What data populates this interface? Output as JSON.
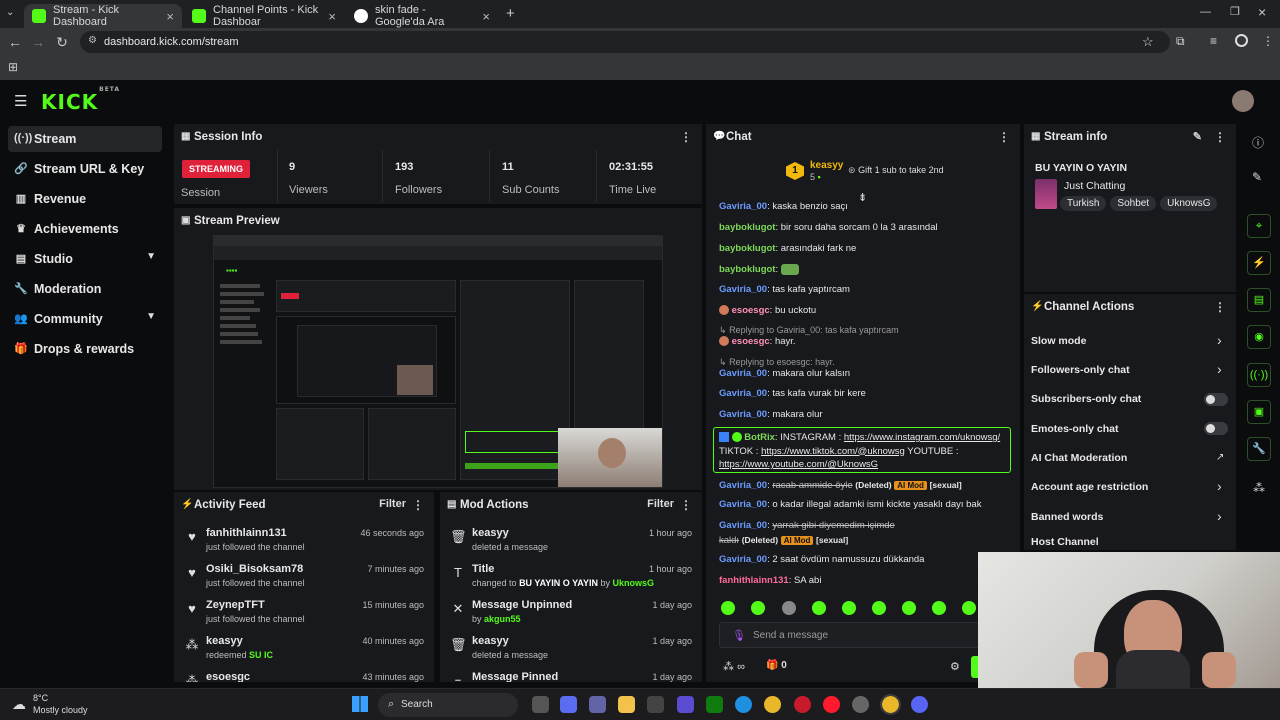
{
  "browser": {
    "tabs": [
      {
        "label": "Stream - Kick Dashboard",
        "active": true
      },
      {
        "label": "Channel Points - Kick Dashboar",
        "active": false
      },
      {
        "label": "skin fade - Google'da Ara",
        "active": false
      }
    ],
    "url": "dashboard.kick.com/stream"
  },
  "brand": {
    "logo": "KICK",
    "beta": "BETA",
    "accent": "#53fc18"
  },
  "sidebar": {
    "items": [
      {
        "label": "Stream",
        "icon": "signal-icon",
        "active": true
      },
      {
        "label": "Stream URL & Key",
        "icon": "link-icon"
      },
      {
        "label": "Revenue",
        "icon": "bank-icon"
      },
      {
        "label": "Achievements",
        "icon": "trophy-icon"
      },
      {
        "label": "Studio",
        "icon": "layers-icon",
        "expandable": true
      },
      {
        "label": "Moderation",
        "icon": "wrench-icon"
      },
      {
        "label": "Community",
        "icon": "people-icon",
        "expandable": true
      },
      {
        "label": "Drops & rewards",
        "icon": "gift-icon"
      }
    ]
  },
  "session": {
    "title": "Session Info",
    "status": "STREAMING",
    "status_label": "Session",
    "stats": [
      {
        "value": "9",
        "label": "Viewers"
      },
      {
        "value": "193",
        "label": "Followers"
      },
      {
        "value": "11",
        "label": "Sub Counts"
      },
      {
        "value": "02:31:55",
        "label": "Time Live"
      }
    ]
  },
  "preview": {
    "title": "Stream Preview"
  },
  "activity": {
    "title": "Activity Feed",
    "filter": "Filter",
    "rows": [
      {
        "name": "fanhithlainn131",
        "sub": "just followed the channel",
        "when": "46 seconds ago",
        "icon": "heart-icon"
      },
      {
        "name": "Osiki_Bisoksam78",
        "sub": "just followed the channel",
        "when": "7 minutes ago",
        "icon": "heart-icon"
      },
      {
        "name": "ZeynepTFT",
        "sub": "just followed the channel",
        "when": "15 minutes ago",
        "icon": "heart-icon"
      },
      {
        "name": "keasyy",
        "sub": "redeemed",
        "sub_hl": "SU IC",
        "when": "40 minutes ago",
        "icon": "points-icon"
      },
      {
        "name": "esoesgc",
        "sub": "",
        "when": "43 minutes ago",
        "icon": "points-icon"
      }
    ]
  },
  "mod": {
    "title": "Mod Actions",
    "filter": "Filter",
    "rows": [
      {
        "name": "keasyy",
        "sub": "deleted a message",
        "when": "1 hour ago",
        "icon": "trash-icon"
      },
      {
        "name": "Title",
        "sub": "changed to",
        "sub_hl": "BU YAYIN O YAYIN",
        "sub_by": "by",
        "sub_user": "UknowsG",
        "when": "1 hour ago",
        "icon": "title-icon"
      },
      {
        "name": "Message Unpinned",
        "sub": "by",
        "sub_user": "akgun55",
        "when": "1 day ago",
        "icon": "unpin-icon"
      },
      {
        "name": "keasyy",
        "sub": "deleted a message",
        "when": "1 day ago",
        "icon": "trash-icon"
      },
      {
        "name": "Message Pinned",
        "sub": "",
        "when": "1 day ago",
        "icon": "pin-icon"
      }
    ]
  },
  "chat": {
    "title": "Chat",
    "top_gifter": {
      "rank": "1",
      "name": "keasyy",
      "count": "5"
    },
    "gift_label": "Gift 1 sub to take 2nd",
    "messages": [
      {
        "user": "Gaviria_00",
        "color": "blue",
        "text": "kaska benzio saçı"
      },
      {
        "user": "bayboklugot",
        "color": "green",
        "text": "bir soru daha sorcam 0 la 3 arasındal"
      },
      {
        "user": "bayboklugot",
        "color": "green",
        "text": "arasındaki fark ne"
      },
      {
        "user": "bayboklugot",
        "color": "green",
        "text": ""
      },
      {
        "user": "Gaviria_00",
        "color": "blue",
        "text": "tas kafa yaptırcam"
      },
      {
        "user": "esoesgc",
        "color": "pink",
        "text": "bu uckotu"
      },
      {
        "reply": "Replying to Gaviria_00: tas kafa yaptırcam"
      },
      {
        "user": "esoesgc",
        "color": "pink",
        "text": "hayr."
      },
      {
        "reply": "Replying to esoesgc: hayr."
      },
      {
        "user": "Gaviria_00",
        "color": "blue",
        "text": "makara olur kalsın"
      },
      {
        "user": "Gaviria_00",
        "color": "blue",
        "text": "tas kafa vurak bir kere"
      },
      {
        "user": "Gaviria_00",
        "color": "blue",
        "text": "makara olur"
      }
    ],
    "bot": {
      "user": "BotRix",
      "line1_pre": "INSTAGRAM :",
      "line1_link": "https://www.instagram.com/uknowsg/",
      "line2_pre": "TIKTOK :",
      "line2_link": "https://www.tiktok.com/@uknowsg",
      "line2_post": "YOUTUBE :",
      "line3_link": "https://www.youtube.com/@UknowsG"
    },
    "messages2": [
      {
        "user": "Gaviria_00",
        "text": "racab ammide öyle",
        "deleted": "(Deleted)",
        "mod": "AI Mod",
        "tag": "[sexual]"
      },
      {
        "user": "Gaviria_00",
        "text": "o kadar illegal adamki ismi kickte yasaklı dayı bak"
      },
      {
        "user": "Gaviria_00",
        "text": "yarrak gibi diyemedim içimde",
        "cont": "kaldı",
        "deleted": "(Deleted)",
        "mod": "AI Mod",
        "tag": "[sexual]"
      },
      {
        "user": "Gaviria_00",
        "text": "2 saat övdüm namussuzu dükkanda"
      },
      {
        "user": "fanhithlainn131",
        "text": "SA abi"
      }
    ],
    "input_placeholder": "Send a message",
    "points": "∞",
    "gift_count": "0"
  },
  "stream_info": {
    "title": "Stream info",
    "stream_title": "BU YAYIN O YAYIN",
    "category": "Just Chatting",
    "tags": [
      "Turkish",
      "Sohbet",
      "UknowsG"
    ]
  },
  "channel_actions": {
    "title": "Channel Actions",
    "rows": [
      {
        "label": "Slow mode",
        "kind": "chevron"
      },
      {
        "label": "Followers-only chat",
        "kind": "chevron"
      },
      {
        "label": "Subscribers-only chat",
        "kind": "toggle"
      },
      {
        "label": "Emotes-only chat",
        "kind": "toggle"
      },
      {
        "label": "AI Chat Moderation",
        "kind": "external"
      },
      {
        "label": "Account age restriction",
        "kind": "chevron"
      },
      {
        "label": "Banned words",
        "kind": "chevron"
      },
      {
        "label": "Host Channel",
        "kind": "none"
      }
    ]
  },
  "taskbar": {
    "temp": "8°C",
    "weather": "Mostly cloudy",
    "search": "Search"
  }
}
